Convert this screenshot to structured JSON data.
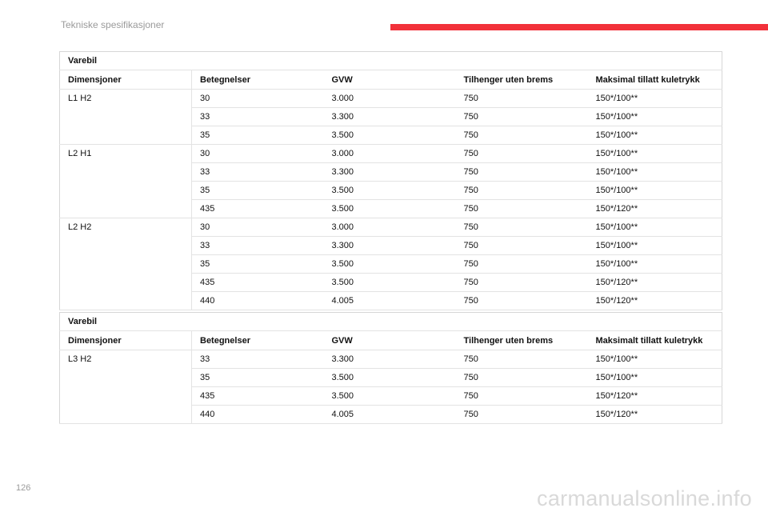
{
  "header": {
    "title": "Tekniske spesifikasjoner",
    "accent_color": "#f2313a"
  },
  "tables": [
    {
      "caption": "Varebil",
      "columns": [
        "Dimensjoner",
        "Betegnelser",
        "GVW",
        "Tilhenger uten brems",
        "Maksimal tillatt kuletrykk"
      ],
      "groups": [
        {
          "dimension": "L1 H2",
          "rows": [
            [
              "30",
              "3.000",
              "750",
              "150*/100**"
            ],
            [
              "33",
              "3.300",
              "750",
              "150*/100**"
            ],
            [
              "35",
              "3.500",
              "750",
              "150*/100**"
            ]
          ]
        },
        {
          "dimension": "L2 H1",
          "rows": [
            [
              "30",
              "3.000",
              "750",
              "150*/100**"
            ],
            [
              "33",
              "3.300",
              "750",
              "150*/100**"
            ],
            [
              "35",
              "3.500",
              "750",
              "150*/100**"
            ],
            [
              "435",
              "3.500",
              "750",
              "150*/120**"
            ]
          ]
        },
        {
          "dimension": "L2 H2",
          "rows": [
            [
              "30",
              "3.000",
              "750",
              "150*/100**"
            ],
            [
              "33",
              "3.300",
              "750",
              "150*/100**"
            ],
            [
              "35",
              "3.500",
              "750",
              "150*/100**"
            ],
            [
              "435",
              "3.500",
              "750",
              "150*/120**"
            ],
            [
              "440",
              "4.005",
              "750",
              "150*/120**"
            ]
          ]
        }
      ]
    },
    {
      "caption": "Varebil",
      "columns": [
        "Dimensjoner",
        "Betegnelser",
        "GVW",
        "Tilhenger uten brems",
        "Maksimalt tillatt kuletrykk"
      ],
      "groups": [
        {
          "dimension": "L3 H2",
          "rows": [
            [
              "33",
              "3.300",
              "750",
              "150*/100**"
            ],
            [
              "35",
              "3.500",
              "750",
              "150*/100**"
            ],
            [
              "435",
              "3.500",
              "750",
              "150*/120**"
            ],
            [
              "440",
              "4.005",
              "750",
              "150*/120**"
            ]
          ]
        }
      ]
    }
  ],
  "footer": {
    "page_number": "126",
    "watermark": "carmanualsonline.info"
  }
}
